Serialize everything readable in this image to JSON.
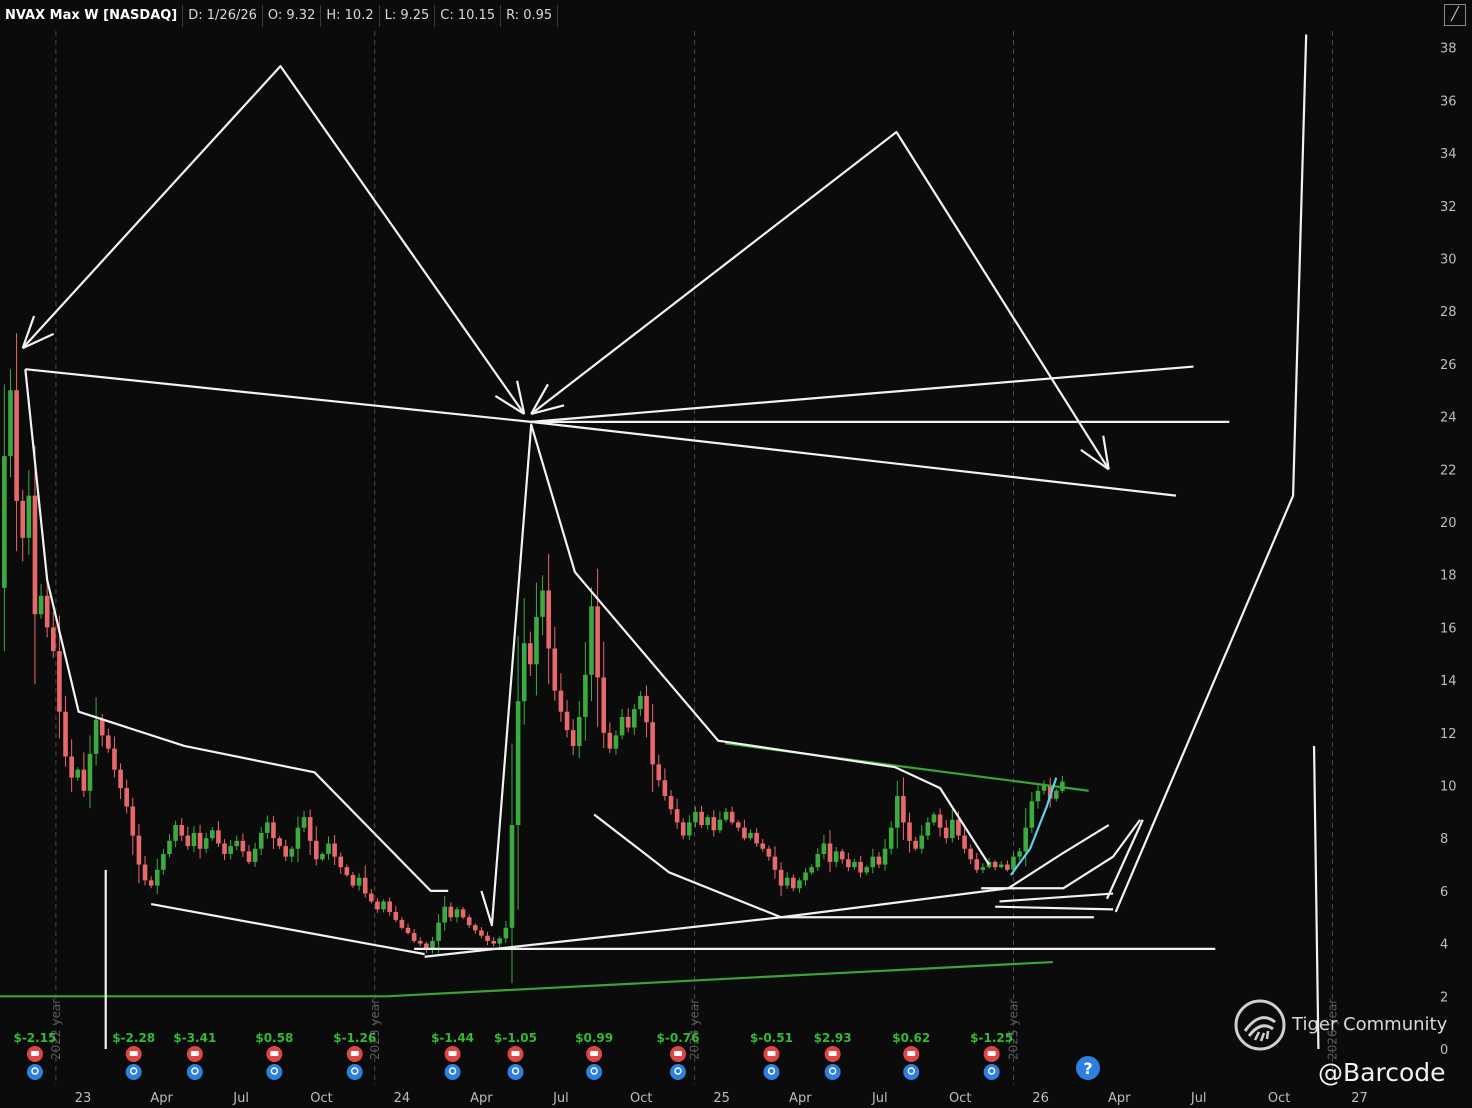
{
  "header": {
    "symbol": "NVAX Max W [NASDAQ]",
    "date": "D: 1/26/26",
    "open": "O: 9.32",
    "high": "H: 10.2",
    "low": "L: 9.25",
    "close": "C: 10.15",
    "range": "R: 0.95"
  },
  "colors": {
    "up": "#3daa3d",
    "down": "#e8696b",
    "background": "#0b0b0b",
    "grid": "#2a2a2a",
    "drawing": "#f2f2f2",
    "trend_green": "#3aa536",
    "cyan": "#5fd0e6"
  },
  "chart_data": {
    "type": "candlestick",
    "title": "NVAX Max W [NASDAQ]",
    "ylim": [
      0,
      38
    ],
    "y_ticks": [
      "0",
      "2",
      "4",
      "6",
      "8",
      "10",
      "12",
      "14",
      "16",
      "18",
      "20",
      "22",
      "24",
      "26",
      "28",
      "30",
      "32",
      "34",
      "36",
      "38"
    ],
    "x_ticks": [
      "23",
      "Apr",
      "Jul",
      "Oct",
      "24",
      "Apr",
      "Jul",
      "Oct",
      "25",
      "Apr",
      "Jul",
      "Oct",
      "26",
      "Apr",
      "Jul",
      "Oct",
      "27"
    ],
    "x_tick_dates": [
      "2023-01-01",
      "2023-04-01",
      "2023-07-01",
      "2023-10-01",
      "2024-01-01",
      "2024-04-01",
      "2024-07-01",
      "2024-10-01",
      "2025-01-01",
      "2025-04-01",
      "2025-07-01",
      "2025-10-01",
      "2026-01-01",
      "2026-04-01",
      "2026-07-01",
      "2026-10-01",
      "2027-01-01"
    ],
    "year_markers": [
      {
        "label": "2022 year",
        "date": "2022-12-01"
      },
      {
        "label": "2023 year",
        "date": "2023-12-01"
      },
      {
        "label": "2024 year",
        "date": "2024-12-01"
      },
      {
        "label": "2025 year",
        "date": "2025-12-01"
      },
      {
        "label": "2026 year",
        "date": "2026-12-01"
      }
    ],
    "earnings": [
      {
        "date": "2022-11-07",
        "eps": "$-2.15"
      },
      {
        "date": "2023-02-28",
        "eps": "$-2.28"
      },
      {
        "date": "2023-05-09",
        "eps": "$-3.41"
      },
      {
        "date": "2023-08-08",
        "eps": "$0.58"
      },
      {
        "date": "2023-11-08",
        "eps": "$-1.26"
      },
      {
        "date": "2024-02-28",
        "eps": "$-1.44"
      },
      {
        "date": "2024-05-10",
        "eps": "$-1.05"
      },
      {
        "date": "2024-08-08",
        "eps": "$0.99"
      },
      {
        "date": "2024-11-12",
        "eps": "$-0.76"
      },
      {
        "date": "2025-02-27",
        "eps": "$-0.51"
      },
      {
        "date": "2025-05-08",
        "eps": "$2.93"
      },
      {
        "date": "2025-08-06",
        "eps": "$0.62"
      },
      {
        "date": "2025-11-06",
        "eps": "$-1.25"
      }
    ],
    "price_path": [
      [
        "2022-09-26",
        17.5
      ],
      [
        "2022-10-03",
        22.5
      ],
      [
        "2022-10-10",
        25.0
      ],
      [
        "2022-10-17",
        20.8
      ],
      [
        "2022-10-24",
        19.4
      ],
      [
        "2022-10-31",
        21.0
      ],
      [
        "2022-11-07",
        16.5
      ],
      [
        "2022-11-14",
        17.2
      ],
      [
        "2022-11-21",
        16.0
      ],
      [
        "2022-11-28",
        15.1
      ],
      [
        "2022-12-05",
        12.8
      ],
      [
        "2022-12-12",
        11.1
      ],
      [
        "2022-12-19",
        10.3
      ],
      [
        "2022-12-26",
        10.6
      ],
      [
        "2023-01-02",
        9.8
      ],
      [
        "2023-01-09",
        11.2
      ],
      [
        "2023-01-16",
        12.5
      ],
      [
        "2023-01-23",
        11.9
      ],
      [
        "2023-01-30",
        11.4
      ],
      [
        "2023-02-06",
        10.6
      ],
      [
        "2023-02-13",
        9.9
      ],
      [
        "2023-02-20",
        9.2
      ],
      [
        "2023-02-27",
        8.1
      ],
      [
        "2023-03-06",
        7.0
      ],
      [
        "2023-03-13",
        6.4
      ],
      [
        "2023-03-20",
        6.2
      ],
      [
        "2023-03-27",
        6.8
      ],
      [
        "2023-04-03",
        7.4
      ],
      [
        "2023-04-10",
        7.9
      ],
      [
        "2023-04-17",
        8.5
      ],
      [
        "2023-04-24",
        8.1
      ],
      [
        "2023-05-01",
        7.7
      ],
      [
        "2023-05-08",
        8.2
      ],
      [
        "2023-05-15",
        7.6
      ],
      [
        "2023-05-22",
        8.0
      ],
      [
        "2023-05-29",
        8.3
      ],
      [
        "2023-06-05",
        7.8
      ],
      [
        "2023-06-12",
        7.4
      ],
      [
        "2023-06-19",
        7.7
      ],
      [
        "2023-06-26",
        7.9
      ],
      [
        "2023-07-03",
        7.5
      ],
      [
        "2023-07-10",
        7.1
      ],
      [
        "2023-07-17",
        7.6
      ],
      [
        "2023-07-24",
        8.2
      ],
      [
        "2023-07-31",
        8.6
      ],
      [
        "2023-08-07",
        8.0
      ],
      [
        "2023-08-14",
        7.7
      ],
      [
        "2023-08-21",
        7.3
      ],
      [
        "2023-08-28",
        7.6
      ],
      [
        "2023-09-04",
        8.4
      ],
      [
        "2023-09-11",
        8.8
      ],
      [
        "2023-09-18",
        7.9
      ],
      [
        "2023-09-25",
        7.2
      ],
      [
        "2023-10-02",
        7.4
      ],
      [
        "2023-10-09",
        7.8
      ],
      [
        "2023-10-16",
        7.3
      ],
      [
        "2023-10-23",
        6.9
      ],
      [
        "2023-10-30",
        6.6
      ],
      [
        "2023-11-06",
        6.2
      ],
      [
        "2023-11-13",
        6.5
      ],
      [
        "2023-11-20",
        5.9
      ],
      [
        "2023-11-27",
        5.6
      ],
      [
        "2023-12-04",
        5.3
      ],
      [
        "2023-12-11",
        5.6
      ],
      [
        "2023-12-18",
        5.2
      ],
      [
        "2023-12-25",
        4.9
      ],
      [
        "2024-01-01",
        4.6
      ],
      [
        "2024-01-08",
        4.4
      ],
      [
        "2024-01-15",
        4.1
      ],
      [
        "2024-01-22",
        4.0
      ],
      [
        "2024-01-29",
        3.8
      ],
      [
        "2024-02-05",
        4.1
      ],
      [
        "2024-02-12",
        4.8
      ],
      [
        "2024-02-19",
        5.4
      ],
      [
        "2024-02-26",
        5.0
      ],
      [
        "2024-03-04",
        5.3
      ],
      [
        "2024-03-11",
        5.0
      ],
      [
        "2024-03-18",
        4.7
      ],
      [
        "2024-03-25",
        4.5
      ],
      [
        "2024-04-01",
        4.3
      ],
      [
        "2024-04-08",
        4.1
      ],
      [
        "2024-04-15",
        4.0
      ],
      [
        "2024-04-22",
        4.2
      ],
      [
        "2024-04-29",
        4.6
      ],
      [
        "2024-05-06",
        8.5
      ],
      [
        "2024-05-13",
        13.2
      ],
      [
        "2024-05-20",
        15.4
      ],
      [
        "2024-05-27",
        14.6
      ],
      [
        "2024-06-03",
        16.4
      ],
      [
        "2024-06-10",
        17.4
      ],
      [
        "2024-06-17",
        15.2
      ],
      [
        "2024-06-24",
        13.6
      ],
      [
        "2024-07-01",
        12.8
      ],
      [
        "2024-07-08",
        12.1
      ],
      [
        "2024-07-15",
        11.5
      ],
      [
        "2024-07-22",
        12.6
      ],
      [
        "2024-07-29",
        14.2
      ],
      [
        "2024-08-05",
        16.8
      ],
      [
        "2024-08-12",
        14.1
      ],
      [
        "2024-08-19",
        12.0
      ],
      [
        "2024-08-26",
        11.4
      ],
      [
        "2024-09-02",
        11.9
      ],
      [
        "2024-09-09",
        12.6
      ],
      [
        "2024-09-16",
        12.2
      ],
      [
        "2024-09-23",
        12.9
      ],
      [
        "2024-09-30",
        13.4
      ],
      [
        "2024-10-07",
        12.4
      ],
      [
        "2024-10-14",
        10.8
      ],
      [
        "2024-10-21",
        10.2
      ],
      [
        "2024-10-28",
        9.6
      ],
      [
        "2024-11-04",
        9.1
      ],
      [
        "2024-11-11",
        8.6
      ],
      [
        "2024-11-18",
        8.1
      ],
      [
        "2024-11-25",
        8.6
      ],
      [
        "2024-12-02",
        9.0
      ],
      [
        "2024-12-09",
        8.5
      ],
      [
        "2024-12-16",
        8.8
      ],
      [
        "2024-12-23",
        8.3
      ],
      [
        "2024-12-30",
        8.7
      ],
      [
        "2025-01-06",
        9.0
      ],
      [
        "2025-01-13",
        8.6
      ],
      [
        "2025-01-20",
        8.4
      ],
      [
        "2025-01-27",
        8.0
      ],
      [
        "2025-02-03",
        8.2
      ],
      [
        "2025-02-10",
        7.8
      ],
      [
        "2025-02-17",
        7.6
      ],
      [
        "2025-02-24",
        7.3
      ],
      [
        "2025-03-03",
        6.8
      ],
      [
        "2025-03-10",
        6.2
      ],
      [
        "2025-03-17",
        6.5
      ],
      [
        "2025-03-24",
        6.1
      ],
      [
        "2025-03-31",
        6.4
      ],
      [
        "2025-04-07",
        6.7
      ],
      [
        "2025-04-14",
        6.9
      ],
      [
        "2025-04-21",
        7.4
      ],
      [
        "2025-04-28",
        7.8
      ],
      [
        "2025-05-05",
        7.1
      ],
      [
        "2025-05-12",
        7.5
      ],
      [
        "2025-05-19",
        7.2
      ],
      [
        "2025-05-26",
        6.9
      ],
      [
        "2025-06-02",
        7.1
      ],
      [
        "2025-06-09",
        6.7
      ],
      [
        "2025-06-16",
        6.9
      ],
      [
        "2025-06-23",
        7.3
      ],
      [
        "2025-06-30",
        7.0
      ],
      [
        "2025-07-07",
        7.6
      ],
      [
        "2025-07-14",
        8.4
      ],
      [
        "2025-07-21",
        9.6
      ],
      [
        "2025-07-28",
        8.6
      ],
      [
        "2025-08-04",
        7.9
      ],
      [
        "2025-08-11",
        7.6
      ],
      [
        "2025-08-18",
        8.1
      ],
      [
        "2025-08-25",
        8.6
      ],
      [
        "2025-09-01",
        8.9
      ],
      [
        "2025-09-08",
        8.4
      ],
      [
        "2025-09-15",
        8.0
      ],
      [
        "2025-09-22",
        8.7
      ],
      [
        "2025-09-29",
        8.1
      ],
      [
        "2025-10-06",
        7.6
      ],
      [
        "2025-10-13",
        7.2
      ],
      [
        "2025-10-20",
        6.8
      ],
      [
        "2025-10-27",
        6.9
      ],
      [
        "2025-11-03",
        7.1
      ],
      [
        "2025-11-10",
        6.9
      ],
      [
        "2025-11-17",
        7.0
      ],
      [
        "2025-11-24",
        6.8
      ],
      [
        "2025-12-01",
        7.3
      ],
      [
        "2025-12-08",
        7.5
      ],
      [
        "2025-12-15",
        8.4
      ],
      [
        "2025-12-22",
        9.4
      ],
      [
        "2025-12-29",
        9.8
      ],
      [
        "2026-01-05",
        10.0
      ],
      [
        "2026-01-12",
        9.5
      ],
      [
        "2026-01-19",
        9.8
      ],
      [
        "2026-01-26",
        10.15
      ]
    ],
    "trend_lines_green": [
      {
        "from": [
          "2022-05-01",
          2.0
        ],
        "to": [
          "2023-12-15",
          2.0
        ]
      },
      {
        "from": [
          "2023-12-15",
          2.0
        ],
        "to": [
          "2026-01-15",
          3.3
        ]
      },
      {
        "from": [
          "2025-01-05",
          11.6
        ],
        "to": [
          "2026-02-25",
          9.8
        ]
      }
    ],
    "annotation_polylines": [
      {
        "style": "arrow",
        "pts": [
          [
            "2022-10-24",
            26.6
          ],
          [
            "2023-08-15",
            37.3
          ],
          [
            "2024-05-20",
            24.1
          ]
        ]
      },
      {
        "style": "arrow",
        "pts": [
          [
            "2024-05-28",
            24.1
          ],
          [
            "2025-07-20",
            34.8
          ],
          [
            "2026-03-20",
            22.0
          ]
        ]
      },
      {
        "style": "line",
        "pts": [
          [
            "2022-10-27",
            25.8
          ],
          [
            "2024-05-28",
            23.8
          ]
        ]
      },
      {
        "style": "line",
        "pts": [
          [
            "2024-05-28",
            23.8
          ],
          [
            "2026-06-25",
            25.9
          ]
        ]
      },
      {
        "style": "line",
        "pts": [
          [
            "2024-05-28",
            23.8
          ],
          [
            "2026-08-05",
            23.8
          ]
        ]
      },
      {
        "style": "line",
        "pts": [
          [
            "2024-05-28",
            23.8
          ],
          [
            "2026-06-05",
            21.0
          ]
        ]
      },
      {
        "style": "line",
        "pts": [
          [
            "2022-10-27",
            25.8
          ],
          [
            "2022-11-21",
            17.8
          ],
          [
            "2022-12-27",
            12.8
          ],
          [
            "2023-04-27",
            11.5
          ],
          [
            "2023-09-23",
            10.5
          ],
          [
            "2024-02-03",
            6.0
          ],
          [
            "2024-02-23",
            6.0
          ]
        ]
      },
      {
        "style": "line",
        "pts": [
          [
            "2024-04-01",
            6.0
          ],
          [
            "2024-04-13",
            4.7
          ],
          [
            "2024-05-28",
            23.7
          ],
          [
            "2024-07-17",
            18.1
          ],
          [
            "2024-12-28",
            11.7
          ],
          [
            "2025-07-18",
            10.7
          ],
          [
            "2025-09-08",
            9.9
          ],
          [
            "2025-11-03",
            7.0
          ]
        ]
      },
      {
        "style": "line",
        "pts": [
          [
            "2023-03-20",
            5.5
          ],
          [
            "2024-01-27",
            3.6
          ]
        ]
      },
      {
        "style": "line",
        "pts": [
          [
            "2024-08-08",
            8.9
          ],
          [
            "2024-11-02",
            6.7
          ],
          [
            "2025-03-10",
            5.0
          ]
        ]
      },
      {
        "style": "line",
        "pts": [
          [
            "2024-01-27",
            3.5
          ],
          [
            "2025-03-10",
            5.0
          ],
          [
            "2025-11-25",
            6.1
          ],
          [
            "2026-01-25",
            7.4
          ],
          [
            "2026-03-20",
            8.5
          ]
        ]
      },
      {
        "style": "line",
        "pts": [
          [
            "2025-03-10",
            5.0
          ],
          [
            "2026-03-03",
            5.0
          ]
        ]
      },
      {
        "style": "line",
        "pts": [
          [
            "2024-01-15",
            3.8
          ],
          [
            "2026-07-20",
            3.8
          ]
        ]
      },
      {
        "style": "line",
        "pts": [
          [
            "2025-11-15",
            5.6
          ],
          [
            "2026-03-25",
            5.9
          ]
        ]
      },
      {
        "style": "line",
        "pts": [
          [
            "2025-11-10",
            5.4
          ],
          [
            "2026-03-25",
            5.3
          ]
        ]
      },
      {
        "style": "line",
        "pts": [
          [
            "2025-10-25",
            6.1
          ],
          [
            "2026-01-27",
            6.1
          ],
          [
            "2026-03-25",
            7.3
          ],
          [
            "2026-04-25",
            8.7
          ]
        ]
      },
      {
        "style": "line",
        "pts": [
          [
            "2026-03-18",
            5.7
          ],
          [
            "2026-04-28",
            8.7
          ]
        ]
      },
      {
        "style": "line",
        "pts": [
          [
            "2026-03-28",
            5.2
          ],
          [
            "2026-10-17",
            21.0
          ],
          [
            "2026-11-01",
            38.5
          ]
        ]
      },
      {
        "style": "line",
        "pts": [
          [
            "2023-01-27",
            6.8
          ],
          [
            "2023-01-27",
            0
          ]
        ]
      },
      {
        "style": "line",
        "pts": [
          [
            "2026-11-10",
            11.5
          ],
          [
            "2026-11-15",
            0
          ]
        ]
      }
    ],
    "cyan_curve": [
      [
        "2025-11-28",
        6.6
      ],
      [
        "2025-12-20",
        7.6
      ],
      [
        "2026-01-08",
        9.2
      ],
      [
        "2026-01-19",
        10.3
      ]
    ]
  },
  "watermark": {
    "brand": "Tiger Community",
    "handle": "@Barcode"
  },
  "help_icon": "?",
  "corner_icon": "scale-toggle-icon"
}
